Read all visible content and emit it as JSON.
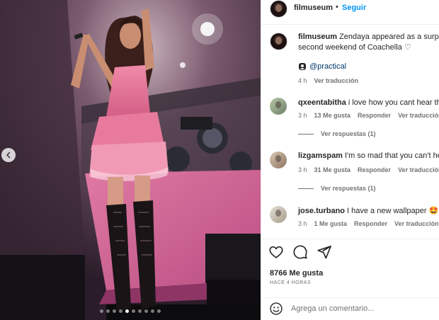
{
  "post": {
    "image_alt": "Concert stage photo",
    "carousel": {
      "total": 10,
      "active": 4
    },
    "account": {
      "username": "filmuseum",
      "separator": "•",
      "follow_label": "Seguir"
    },
    "caption": {
      "username": "filmuseum",
      "line1": "Zendaya appeared as a surprise",
      "line2": "second weekend of Coachella ♡",
      "tag_label": "@practical",
      "time": "4 h",
      "translate_label": "Ver traducción"
    },
    "comments": [
      {
        "username": "qxeentabitha",
        "text": "i love how you cant hear the",
        "time": "3 h",
        "likes": "13 Me gusta",
        "reply_label": "Responder",
        "translate_label": "Ver traducción",
        "view_replies": "Ver respuestas (1)"
      },
      {
        "username": "lizgamspam",
        "text": "I'm so mad that you can't hea",
        "time": "3 h",
        "likes": "31 Me gusta",
        "reply_label": "Responder",
        "translate_label": "Ver traducción",
        "view_replies": "Ver respuestas (1)"
      },
      {
        "username": "jose.turbano",
        "text": "I have a new wallpaper 🤩",
        "time": "3 h",
        "likes": "1 Me gusta",
        "reply_label": "Responder",
        "translate_label": "Ver traducción"
      }
    ],
    "likes_label": "8766 Me gusta",
    "time_ago": "HACE 4 HORAS",
    "comment_placeholder": "Agrega un comentario...",
    "icons": {
      "like": "heart-icon",
      "comment": "comment-bubble-icon",
      "share": "paper-plane-icon",
      "emoji": "smiley-icon",
      "prev": "chevron-left-icon",
      "tag": "user-tag-icon"
    },
    "colors": {
      "link": "#0095f6",
      "secondary_text": "#737373",
      "tag_text": "#00376b"
    }
  }
}
